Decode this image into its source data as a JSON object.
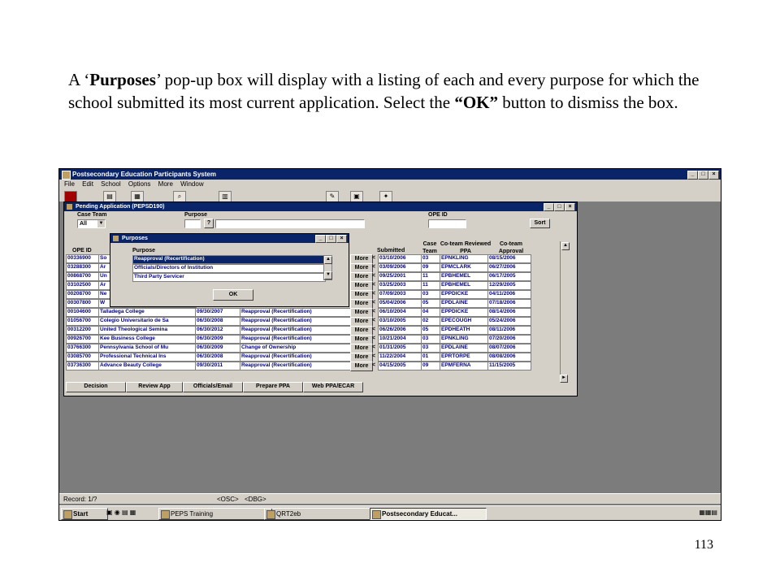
{
  "caption": {
    "p1": "A ‘",
    "b1": "Purposes",
    "p2": "’ pop-up box will display with a listing of each and every purpose for which the school submitted its most current application.  Select the ",
    "b2": "“OK”",
    "p3": " button to dismiss the box."
  },
  "page_number": "113",
  "app": {
    "title": "Postsecondary Education Participants System",
    "menu": [
      "File",
      "Edit",
      "School",
      "Options",
      "More",
      "Window"
    ],
    "status": {
      "record": "Record: 1/?",
      "osc": "<OSC>",
      "dbg": "<DBG>"
    }
  },
  "taskbar": {
    "start": "Start",
    "tasks": [
      "PEPS Training",
      "QRT2eb",
      "Postsecondary Educat..."
    ]
  },
  "pending": {
    "title": "Pending Application (PEPSD190)",
    "case_team_label": "Case  Team",
    "case_team_value": "All",
    "purpose_label": "Purpose",
    "ope_id_label": "OPE ID",
    "sort_button": "Sort",
    "columns": {
      "ope_id": "OPE ID",
      "submitted": "Submitted",
      "case_team": "Case Team",
      "co_team_reviewed": "Co-team Reviewed PPA",
      "co_team_approval": "Co-team Approval"
    },
    "more_label": "More",
    "rows": [
      {
        "ope": "00336900",
        "name": "So",
        "date": "",
        "purpose": "",
        "submitted": "03/10/2006",
        "team": "03",
        "reviewer": "EPNKLING",
        "approval": "08/15/2006"
      },
      {
        "ope": "03288300",
        "name": "Ar",
        "date": "",
        "purpose": "",
        "submitted": "03/09/2006",
        "team": "09",
        "reviewer": "EPMCLARK",
        "approval": "06/27/2006"
      },
      {
        "ope": "00868700",
        "name": "Un",
        "date": "",
        "purpose": "",
        "submitted": "09/25/2001",
        "team": "11",
        "reviewer": "EPBHEMEL",
        "approval": "06/17/2005"
      },
      {
        "ope": "03102500",
        "name": "Ar",
        "date": "",
        "purpose": "",
        "submitted": "03/25/2003",
        "team": "11",
        "reviewer": "EPBHEMEL",
        "approval": "12/29/2005"
      },
      {
        "ope": "00208700",
        "name": "Ne",
        "date": "",
        "purpose": "",
        "submitted": "07/09/2003",
        "team": "03",
        "reviewer": "EPPDICKE",
        "approval": "04/11/2006"
      },
      {
        "ope": "00307800",
        "name": "W",
        "date": "",
        "purpose": "",
        "submitted": "05/04/2006",
        "team": "05",
        "reviewer": "EPDLAINE",
        "approval": "07/18/2006"
      },
      {
        "ope": "00104600",
        "name": "Talladega College",
        "date": "09/30/2007",
        "purpose": "Reapproval (Recertification)",
        "submitted": "06/10/2004",
        "team": "04",
        "reviewer": "EPPDICKE",
        "approval": "08/14/2006"
      },
      {
        "ope": "01056700",
        "name": "Colegio Universitario de Sa",
        "date": "06/30/2008",
        "purpose": "Reapproval (Recertification)",
        "submitted": "03/10/2005",
        "team": "02",
        "reviewer": "EPECOUGH",
        "approval": "05/24/2006"
      },
      {
        "ope": "00312200",
        "name": "United Theological Semina",
        "date": "06/30/2012",
        "purpose": "Reapproval (Recertification)",
        "submitted": "06/26/2006",
        "team": "05",
        "reviewer": "EPDHEATH",
        "approval": "08/11/2006"
      },
      {
        "ope": "00926700",
        "name": "Kee Business College",
        "date": "06/30/2009",
        "purpose": "Reapproval (Recertification)",
        "submitted": "10/21/2004",
        "team": "03",
        "reviewer": "EPNKLING",
        "approval": "07/20/2006"
      },
      {
        "ope": "03766300",
        "name": "Pennsylvania School of Mu",
        "date": "06/30/2009",
        "purpose": "Change of Ownership",
        "submitted": "01/31/2005",
        "team": "03",
        "reviewer": "EPDLAINE",
        "approval": "08/07/2006"
      },
      {
        "ope": "03085700",
        "name": "Professional Technical Ins",
        "date": "06/30/2008",
        "purpose": "Reapproval (Recertification)",
        "submitted": "11/22/2004",
        "team": "01",
        "reviewer": "EPRTORPE",
        "approval": "08/08/2006"
      },
      {
        "ope": "03736300",
        "name": "Advance Beauty College",
        "date": "09/30/2011",
        "purpose": "Reapproval (Recertification)",
        "submitted": "04/15/2005",
        "team": "09",
        "reviewer": "EPMFERNA",
        "approval": "11/15/2005"
      }
    ],
    "buttons": [
      "Decision",
      "Review App",
      "Officials/Email",
      "Prepare PPA",
      "Web PPA/ECAR"
    ]
  },
  "popup": {
    "title": "Purposes",
    "column_label": "Purpose",
    "items": [
      "Reapproval (Recertification)",
      "Officials/Directors of Institution",
      "Third Party Servicer"
    ],
    "ok_label": "OK"
  },
  "colors": {
    "titlebar": "#0a246a",
    "desktop": "#7c7c7c",
    "chrome": "#d4d0c8",
    "cell_text": "#000080"
  }
}
